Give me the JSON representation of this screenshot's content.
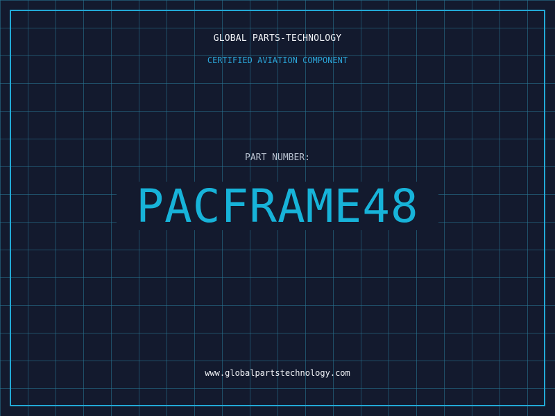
{
  "header": {
    "company": "GLOBAL PARTS-TECHNOLOGY",
    "subtitle": "CERTIFIED AVIATION COMPONENT"
  },
  "part": {
    "label": "PART NUMBER:",
    "number": "PACFRAME48"
  },
  "footer": {
    "website": "www.globalpartstechnology.com"
  },
  "colors": {
    "background": "#131a2e",
    "grid": "#28789a",
    "accent": "#17b3d9",
    "frame": "#22a9d6"
  }
}
